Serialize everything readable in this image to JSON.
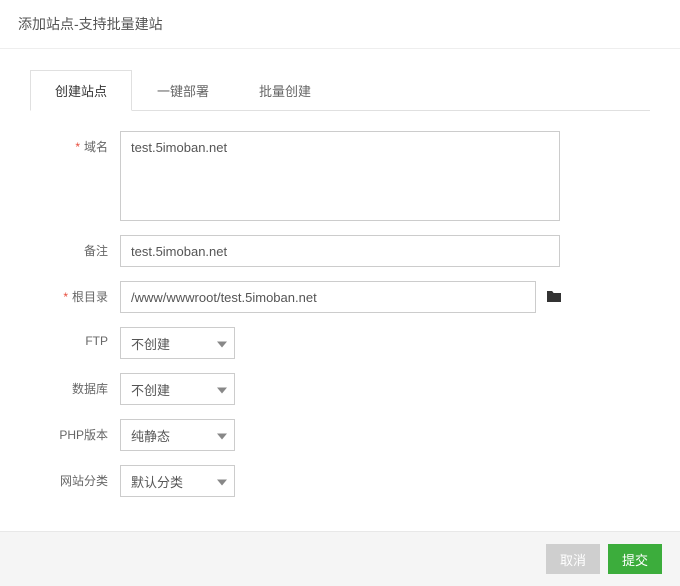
{
  "header": {
    "title": "添加站点-支持批量建站"
  },
  "tabs": {
    "create": "创建站点",
    "deploy": "一键部署",
    "batch": "批量创建"
  },
  "form": {
    "domain": {
      "label": "域名",
      "value": "test.5imoban.net",
      "required": true
    },
    "remark": {
      "label": "备注",
      "value": "test.5imoban.net",
      "required": false
    },
    "root": {
      "label": "根目录",
      "value": "/www/wwwroot/test.5imoban.net",
      "required": true
    },
    "ftp": {
      "label": "FTP",
      "value": "不创建"
    },
    "database": {
      "label": "数据库",
      "value": "不创建"
    },
    "php": {
      "label": "PHP版本",
      "value": "纯静态"
    },
    "category": {
      "label": "网站分类",
      "value": "默认分类"
    }
  },
  "footer": {
    "cancel": "取消",
    "submit": "提交"
  }
}
